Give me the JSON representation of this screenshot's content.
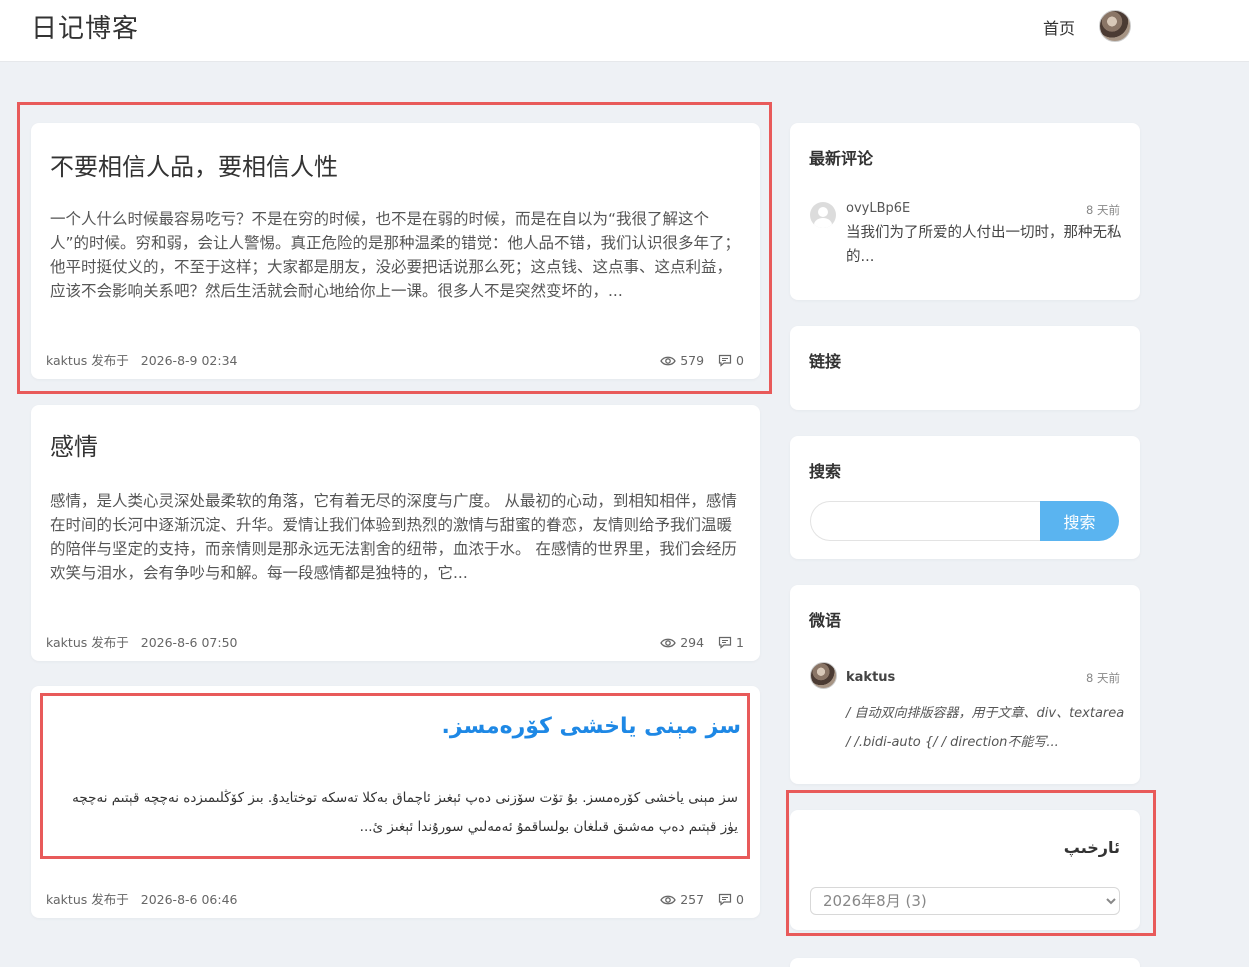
{
  "header": {
    "site_title": "日记博客",
    "nav_home": "首页"
  },
  "posts": [
    {
      "title": "不要相信人品，要相信人性",
      "excerpt": "一个人什么时候最容易吃亏？不是在穷的时候，也不是在弱的时候，而是在自以为“我很了解这个人”的时候。穷和弱，会让人警惕。真正危险的是那种温柔的错觉：他人品不错，我们认识很多年了；他平时挺仗义的，不至于这样；大家都是朋友，没必要把话说那么死；这点钱、这点事、这点利益，应该不会影响关系吧？然后生活就会耐心地给你上一课。很多人不是突然变坏的，...",
      "author": "kaktus",
      "published_label": "发布于",
      "date": "2026-8-9 02:34",
      "views": "579",
      "comments": "0"
    },
    {
      "title": "感情",
      "excerpt": "感情，是人类心灵深处最柔软的角落，它有着无尽的深度与广度。 从最初的心动，到相知相伴，感情在时间的长河中逐渐沉淀、升华。爱情让我们体验到热烈的激情与甜蜜的眷恋，友情则给予我们温暖的陪伴与坚定的支持，而亲情则是那永远无法割舍的纽带，血浓于水。 在感情的世界里，我们会经历欢笑与泪水，会有争吵与和解。每一段感情都是独特的，它...",
      "author": "kaktus",
      "published_label": "发布于",
      "date": "2026-8-6 07:50",
      "views": "294",
      "comments": "1"
    },
    {
      "title": "سز مېنى ياخشى كۆرەمسز.",
      "excerpt": "سز مېنى ياخشى كۆرەمسز. بۇ تۆت سۆزنى دەپ ئېغىز ئاچماق بەكلا تەسكە توختايدۇ. بىز كۆڭلىمىزدە نەچچە قېتىم نەچچە يۈز قېتىم دەپ مەشىق قىلغان بولساقمۇ ئەمەلىي سورۇندا ئېغىز ئ...",
      "author": "kaktus",
      "published_label": "发布于",
      "date": "2026-8-6 06:46",
      "views": "257",
      "comments": "0"
    }
  ],
  "sidebar": {
    "latest_comments": {
      "title": "最新评论",
      "user": "ovyLBp6E",
      "time": "8 天前",
      "text": "当我们为了所爱的人付出一切时，那种无私的..."
    },
    "links": {
      "title": "链接"
    },
    "search": {
      "title": "搜索",
      "button": "搜索",
      "placeholder": ""
    },
    "weiyu": {
      "title": "微语",
      "user": "kaktus",
      "time": "8 天前",
      "text": "/ 自动双向排版容器，用于文章、div、textarea / /.bidi-auto {/ / direction不能写..."
    },
    "archive": {
      "title": "ئارخىپ",
      "selected": "2026年8月 (3)"
    }
  },
  "colors": {
    "accent_blue": "#5ab4f0",
    "link_blue": "#1e88e5",
    "highlight_red": "#e85a5a",
    "page_bg": "#eef1f5"
  }
}
